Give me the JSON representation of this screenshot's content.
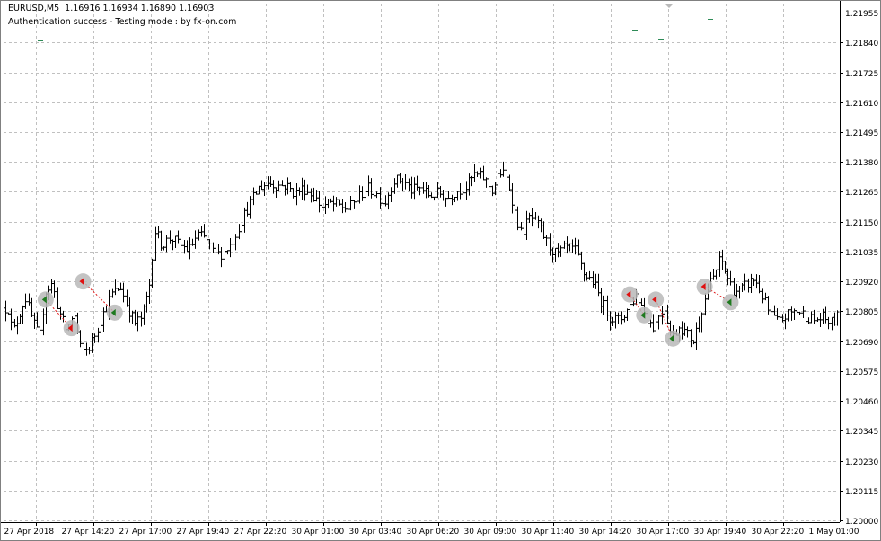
{
  "header": {
    "symbol": "EURUSD,M5",
    "ohlc": "1.16916 1.16934 1.16890 1.16903",
    "status": "Authentication success - Testing mode : by fx-on.com"
  },
  "colors": {
    "background": "#ffffff",
    "grid": "#c0c0c0",
    "bars": "#000000",
    "buy_marker": "#1f7a1f",
    "sell_marker": "#e01010",
    "marker_halo": "#b9b9b9",
    "tick_marks": "#2e8b57"
  },
  "chart_data": {
    "type": "ohlc",
    "title": "EURUSD,M5",
    "subtitle": "Authentication success - Testing mode : by fx-on.com",
    "xlabel": "",
    "ylabel": "",
    "ylim": [
      1.2,
      1.2199
    ],
    "y_ticks": [
      "1.21955",
      "1.21840",
      "1.21725",
      "1.21610",
      "1.21495",
      "1.21380",
      "1.21265",
      "1.21150",
      "1.21035",
      "1.20920",
      "1.20805",
      "1.20690",
      "1.20575",
      "1.20460",
      "1.20345",
      "1.20230",
      "1.20115",
      "1.20000"
    ],
    "x_ticks": [
      "27 Apr 2018",
      "27 Apr 14:20",
      "27 Apr 17:00",
      "27 Apr 19:40",
      "27 Apr 22:20",
      "30 Apr 01:00",
      "30 Apr 03:40",
      "30 Apr 06:20",
      "30 Apr 09:00",
      "30 Apr 11:40",
      "30 Apr 14:20",
      "30 Apr 17:00",
      "30 Apr 19:40",
      "30 Apr 22:20",
      "1 May 01:00"
    ],
    "grid": true,
    "bar_count": 290,
    "price_path": [
      [
        0,
        1.2075
      ],
      [
        8,
        1.2084
      ],
      [
        14,
        1.2072
      ],
      [
        20,
        1.2078
      ],
      [
        28,
        1.2086
      ],
      [
        36,
        1.2077
      ],
      [
        44,
        1.207
      ],
      [
        50,
        1.2088
      ],
      [
        58,
        1.2091
      ],
      [
        66,
        1.208
      ],
      [
        74,
        1.2073
      ],
      [
        82,
        1.208
      ],
      [
        90,
        1.2065
      ],
      [
        98,
        1.2066
      ],
      [
        106,
        1.2072
      ],
      [
        114,
        1.2079
      ],
      [
        124,
        1.2087
      ],
      [
        134,
        1.209
      ],
      [
        142,
        1.2082
      ],
      [
        150,
        1.2076
      ],
      [
        158,
        1.2078
      ],
      [
        166,
        1.209
      ],
      [
        172,
        1.2112
      ],
      [
        180,
        1.2106
      ],
      [
        190,
        1.2109
      ],
      [
        200,
        1.2106
      ],
      [
        210,
        1.2104
      ],
      [
        220,
        1.211
      ],
      [
        230,
        1.2108
      ],
      [
        238,
        1.2102
      ],
      [
        248,
        1.2103
      ],
      [
        258,
        1.2107
      ],
      [
        268,
        1.2115
      ],
      [
        278,
        1.2122
      ],
      [
        288,
        1.2128
      ],
      [
        298,
        1.213
      ],
      [
        308,
        1.2129
      ],
      [
        318,
        1.2129
      ],
      [
        328,
        1.2126
      ],
      [
        338,
        1.2128
      ],
      [
        348,
        1.2125
      ],
      [
        358,
        1.2121
      ],
      [
        368,
        1.2122
      ],
      [
        378,
        1.2121
      ],
      [
        388,
        1.212
      ],
      [
        398,
        1.2124
      ],
      [
        408,
        1.2128
      ],
      [
        418,
        1.2126
      ],
      [
        428,
        1.2122
      ],
      [
        438,
        1.2131
      ],
      [
        448,
        1.2131
      ],
      [
        458,
        1.2127
      ],
      [
        468,
        1.2128
      ],
      [
        478,
        1.2125
      ],
      [
        488,
        1.2126
      ],
      [
        498,
        1.2124
      ],
      [
        508,
        1.2127
      ],
      [
        518,
        1.2128
      ],
      [
        528,
        1.2133
      ],
      [
        538,
        1.2132
      ],
      [
        548,
        1.2127
      ],
      [
        556,
        1.2134
      ],
      [
        562,
        1.2133
      ],
      [
        568,
        1.2127
      ],
      [
        572,
        1.212
      ],
      [
        580,
        1.211
      ],
      [
        590,
        1.2117
      ],
      [
        600,
        1.2113
      ],
      [
        610,
        1.2106
      ],
      [
        620,
        1.2102
      ],
      [
        630,
        1.2105
      ],
      [
        640,
        1.2104
      ],
      [
        650,
        1.2095
      ],
      [
        660,
        1.2092
      ],
      [
        670,
        1.2084
      ],
      [
        680,
        1.2078
      ],
      [
        690,
        1.2077
      ],
      [
        700,
        1.2082
      ],
      [
        708,
        1.2087
      ],
      [
        714,
        1.2083
      ],
      [
        720,
        1.2078
      ],
      [
        728,
        1.2074
      ],
      [
        734,
        1.208
      ],
      [
        740,
        1.2082
      ],
      [
        748,
        1.207
      ],
      [
        756,
        1.2075
      ],
      [
        764,
        1.2072
      ],
      [
        772,
        1.2069
      ],
      [
        780,
        1.208
      ],
      [
        788,
        1.2089
      ],
      [
        796,
        1.2095
      ],
      [
        802,
        1.2101
      ],
      [
        808,
        1.2095
      ],
      [
        816,
        1.2089
      ],
      [
        824,
        1.2088
      ],
      [
        832,
        1.2091
      ],
      [
        840,
        1.2093
      ],
      [
        848,
        1.2087
      ],
      [
        856,
        1.208
      ],
      [
        866,
        1.2076
      ],
      [
        876,
        1.2079
      ],
      [
        886,
        1.2081
      ],
      [
        896,
        1.2079
      ],
      [
        906,
        1.2077
      ],
      [
        916,
        1.2078
      ],
      [
        926,
        1.2076
      ],
      [
        934,
        1.2079
      ]
    ],
    "trades": [
      {
        "type": "buy",
        "bar": 14,
        "price": 1.2085
      },
      {
        "type": "sell",
        "bar": 23,
        "price": 1.2074
      },
      {
        "type": "sell",
        "bar": 27,
        "price": 1.2092
      },
      {
        "type": "buy",
        "bar": 38,
        "price": 1.208
      },
      {
        "type": "sell",
        "bar": 217,
        "price": 1.2087
      },
      {
        "type": "buy",
        "bar": 222,
        "price": 1.2079
      },
      {
        "type": "sell",
        "bar": 226,
        "price": 1.2085
      },
      {
        "type": "buy",
        "bar": 232,
        "price": 1.207
      },
      {
        "type": "sell",
        "bar": 243,
        "price": 1.209
      },
      {
        "type": "buy",
        "bar": 252,
        "price": 1.2084
      }
    ]
  }
}
